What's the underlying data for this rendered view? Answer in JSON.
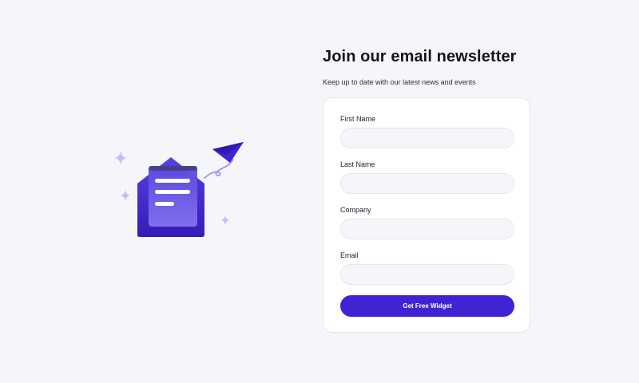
{
  "newsletter": {
    "title": "Join our email newsletter",
    "subtitle": "Keep up to date with our latest news and events"
  },
  "form": {
    "fields": [
      {
        "label": "First Name",
        "value": "",
        "placeholder": ""
      },
      {
        "label": "Last Name",
        "value": "",
        "placeholder": ""
      },
      {
        "label": "Company",
        "value": "",
        "placeholder": ""
      },
      {
        "label": "Email",
        "value": "",
        "placeholder": ""
      }
    ],
    "submit_label": "Get Free Widget"
  },
  "illustration": {
    "icons": [
      "sparkle-icon",
      "envelope-icon",
      "document-icon",
      "paper-plane-icon"
    ]
  },
  "colors": {
    "background": "#f5f6fa",
    "accent": "#4024d4",
    "card": "#ffffff",
    "input_background": "#f5f6fa",
    "sparkle": "#c8bdf6"
  }
}
